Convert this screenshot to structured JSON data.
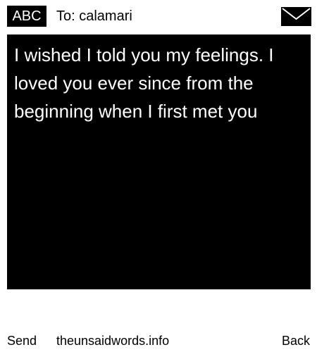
{
  "header": {
    "input_mode": "ABC",
    "recipient": "To: calamari",
    "icon": "envelope-icon"
  },
  "message": {
    "text": "I wished I told you my feelings. I loved you ever since from the beginning when I first met you"
  },
  "footer": {
    "left_softkey": "Send",
    "center_text": "theunsaidwords.info",
    "right_softkey": "Back"
  },
  "colors": {
    "background": "#ffffff",
    "message_background": "#000000",
    "message_text": "#ffffff",
    "text": "#000000"
  }
}
